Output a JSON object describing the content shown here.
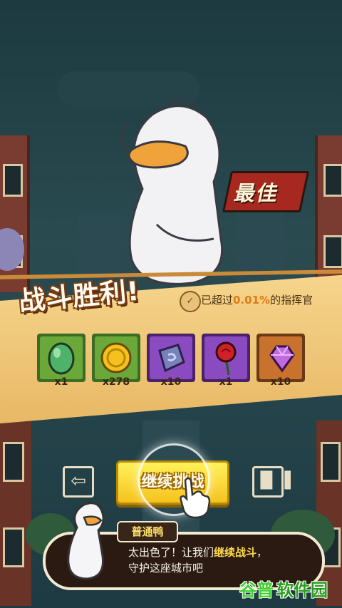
{
  "result": {
    "best_label": "最佳",
    "victory_title": "战斗胜利!",
    "rank_prefix": "已超过",
    "rank_percent": "0.01%",
    "rank_suffix": "的指挥官"
  },
  "rewards": [
    {
      "item": "green-egg",
      "count": "x1",
      "color": "#6aa83a"
    },
    {
      "item": "gold-coin",
      "count": "x278",
      "color": "#6aa83a"
    },
    {
      "item": "rune-stone",
      "count": "x10",
      "color": "#8a4bc0"
    },
    {
      "item": "red-rose",
      "count": "x1",
      "color": "#8a4bc0"
    },
    {
      "item": "purple-gem",
      "count": "x10",
      "color": "#c8722e"
    }
  ],
  "actions": {
    "exit_icon": "exit-icon",
    "continue_label": "继续挑战",
    "stats_icon": "bar-chart-icon"
  },
  "dialog": {
    "speaker": "普通鸭",
    "line1_pre": "太出色了！让我们",
    "line1_highlight": "继续战斗",
    "line1_post": "，",
    "line2": "守护这座城市吧"
  },
  "watermark": {
    "logo": "谷普",
    "text": "软件园"
  },
  "colors": {
    "accent_yellow": "#f5c21d",
    "highlight": "#ffd84a",
    "best_tag": "#a6281f"
  }
}
